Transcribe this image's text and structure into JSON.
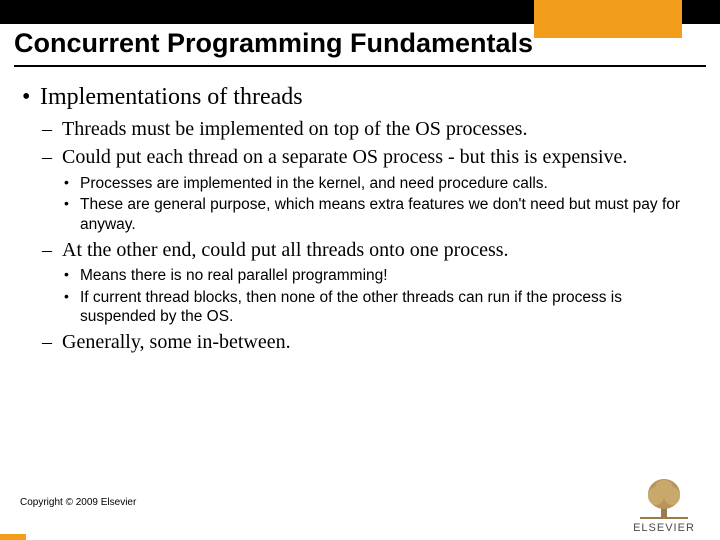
{
  "title": "Concurrent Programming Fundamentals",
  "bullets": {
    "l1": "Implementations of threads",
    "l2a": "Threads must be implemented on top of the OS processes.",
    "l2b": "Could put each thread on a separate OS process - but this is expensive.",
    "l3a": "Processes are implemented in the kernel, and need procedure calls.",
    "l3b": "These are general purpose, which means extra features we don't need but must pay for anyway.",
    "l2c": "At the other end, could put all threads onto one process.",
    "l3c": "Means there is no real parallel programming!",
    "l3d": "If current thread blocks, then none of the other threads can run if the process is suspended by the OS.",
    "l2d": "Generally, some in-between."
  },
  "copyright": "Copyright © 2009 Elsevier",
  "publisher": "ELSEVIER",
  "colors": {
    "accent": "#f39d1d",
    "text": "#000000"
  }
}
